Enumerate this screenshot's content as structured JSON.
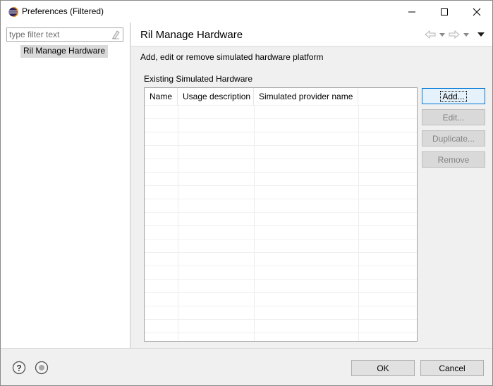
{
  "window": {
    "title": "Preferences (Filtered)"
  },
  "filter": {
    "placeholder": "type filter text"
  },
  "tree": {
    "items": [
      {
        "label": "Ril Manage Hardware"
      }
    ]
  },
  "page": {
    "title": "Ril Manage Hardware",
    "description": "Add, edit or remove simulated hardware platform",
    "group_label": "Existing Simulated Hardware"
  },
  "table": {
    "columns": [
      "Name",
      "Usage description",
      "Simulated provider name",
      ""
    ],
    "rows": []
  },
  "buttons": {
    "add": "Add...",
    "edit": "Edit...",
    "duplicate": "Duplicate...",
    "remove": "Remove",
    "ok": "OK",
    "cancel": "Cancel"
  },
  "icons": {
    "app": "eclipse-icon",
    "minimize": "minimize-icon",
    "maximize": "maximize-icon",
    "close": "close-icon",
    "clear": "clear-filter-icon",
    "back": "back-arrow-icon",
    "forward": "forward-arrow-icon",
    "menu": "view-menu-icon",
    "help": "help-icon",
    "import": "import-export-icon"
  }
}
